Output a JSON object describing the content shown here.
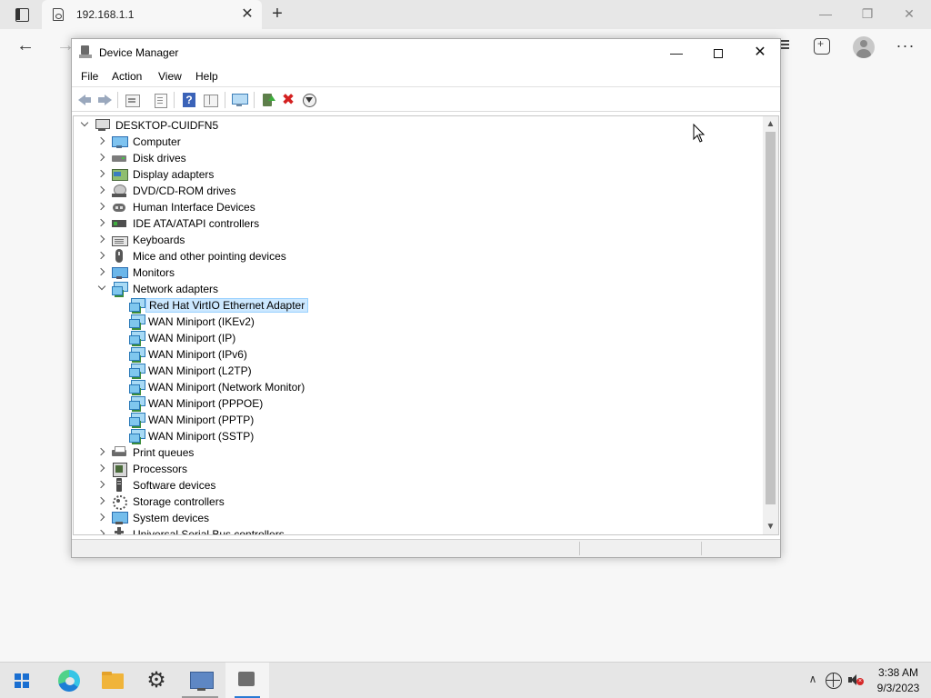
{
  "browser": {
    "tab_title": "192.168.1.1",
    "tab_close": "✕",
    "new_tab": "+",
    "minimize": "—",
    "restore": "❐",
    "close": "✕",
    "back": "←",
    "forward": "→",
    "more": "···"
  },
  "window": {
    "title": "Device Manager",
    "minimize": "—",
    "close": "✕"
  },
  "menu": {
    "file": "File",
    "action": "Action",
    "view": "View",
    "help": "Help"
  },
  "toolbar": {
    "remove": "✖"
  },
  "tree": {
    "root": "DESKTOP-CUIDFN5",
    "categories": [
      {
        "label": "Computer",
        "icon": "computer-icon"
      },
      {
        "label": "Disk drives",
        "icon": "disk-drive-icon"
      },
      {
        "label": "Display adapters",
        "icon": "display-adapter-icon"
      },
      {
        "label": "DVD/CD-ROM drives",
        "icon": "dvd-drive-icon"
      },
      {
        "label": "Human Interface Devices",
        "icon": "hid-icon"
      },
      {
        "label": "IDE ATA/ATAPI controllers",
        "icon": "ide-controller-icon"
      },
      {
        "label": "Keyboards",
        "icon": "keyboard-icon"
      },
      {
        "label": "Mice and other pointing devices",
        "icon": "mouse-icon"
      },
      {
        "label": "Monitors",
        "icon": "monitor-icon"
      },
      {
        "label": "Network adapters",
        "icon": "network-adapter-icon"
      }
    ],
    "network_adapters": [
      "Red Hat VirtIO Ethernet Adapter",
      "WAN Miniport (IKEv2)",
      "WAN Miniport (IP)",
      "WAN Miniport (IPv6)",
      "WAN Miniport (L2TP)",
      "WAN Miniport (Network Monitor)",
      "WAN Miniport (PPPOE)",
      "WAN Miniport (PPTP)",
      "WAN Miniport (SSTP)"
    ],
    "categories_after": [
      {
        "label": "Print queues",
        "icon": "print-queue-icon"
      },
      {
        "label": "Processors",
        "icon": "processor-icon"
      },
      {
        "label": "Software devices",
        "icon": "software-device-icon"
      },
      {
        "label": "Storage controllers",
        "icon": "storage-controller-icon"
      },
      {
        "label": "System devices",
        "icon": "system-device-icon"
      },
      {
        "label": "Universal Serial Bus controllers",
        "icon": "usb-icon"
      }
    ]
  },
  "scrollbar": {
    "up": "▲",
    "down": "▼"
  },
  "taskbar": {
    "settings": "⚙",
    "tray_chevron": "∧",
    "time": "3:38 AM",
    "date": "9/3/2023"
  }
}
